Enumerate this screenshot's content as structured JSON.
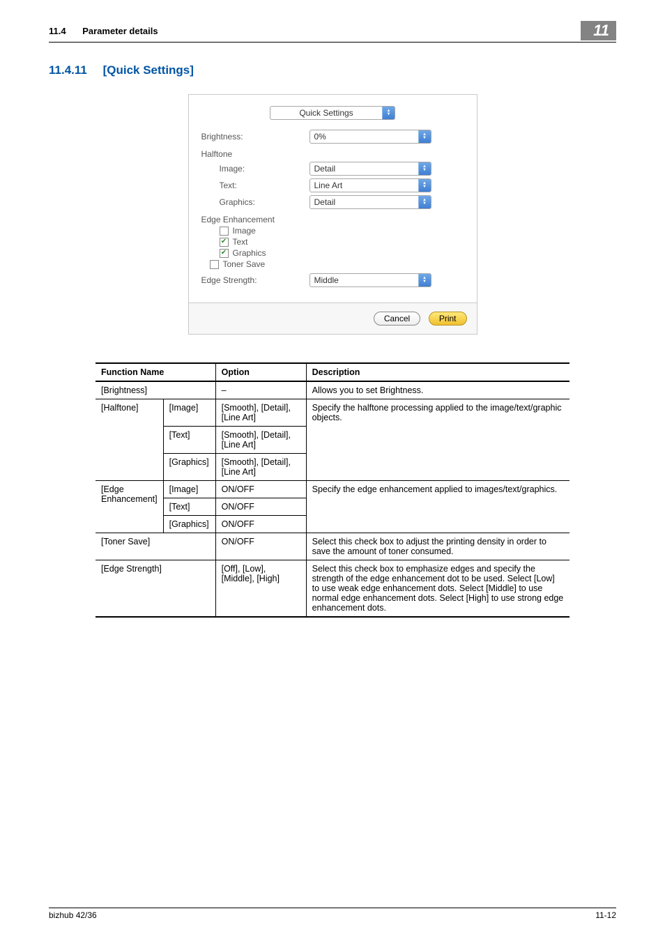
{
  "header": {
    "section_no": "11.4",
    "section_title": "Parameter details",
    "chapter_no": "11"
  },
  "section_heading": {
    "number": "11.4.11",
    "title": "[Quick Settings]"
  },
  "panel": {
    "top_combo": "Quick Settings",
    "brightness_label": "Brightness:",
    "brightness_value": "0%",
    "halftone_label": "Halftone",
    "halftone_image_label": "Image:",
    "halftone_image_value": "Detail",
    "halftone_text_label": "Text:",
    "halftone_text_value": "Line Art",
    "halftone_graphics_label": "Graphics:",
    "halftone_graphics_value": "Detail",
    "edge_enh_label": "Edge Enhancement",
    "chk_image": "Image",
    "chk_text": "Text",
    "chk_graphics": "Graphics",
    "chk_toner": "Toner Save",
    "edge_strength_label": "Edge Strength:",
    "edge_strength_value": "Middle",
    "btn_cancel": "Cancel",
    "btn_print": "Print"
  },
  "table": {
    "head": {
      "fn": "Function Name",
      "opt": "Option",
      "desc": "Description"
    },
    "rows": {
      "brightness": {
        "fn": "[Brightness]",
        "opt": "–",
        "desc": "Allows you to set Brightness."
      },
      "halftone": {
        "fn": "[Halftone]",
        "sub_image": "[Image]",
        "sub_text": "[Text]",
        "sub_graphics": "[Graphics]",
        "opt": "[Smooth], [Detail], [Line Art]",
        "desc": "Specify the halftone processing applied to the image/text/graphic objects."
      },
      "edge": {
        "fn": "[Edge Enhancement]",
        "sub_image": "[Image]",
        "sub_text": "[Text]",
        "sub_graphics": "[Graphics]",
        "opt": "ON/OFF",
        "desc": "Specify the edge enhancement applied to images/text/graphics."
      },
      "toner": {
        "fn": "[Toner Save]",
        "opt": "ON/OFF",
        "desc": "Select this check box to adjust the printing density in order to save the amount of toner consumed."
      },
      "strength": {
        "fn": "[Edge Strength]",
        "opt": "[Off], [Low], [Middle], [High]",
        "desc": "Select this check box to emphasize edges and specify the strength of the edge enhancement dot to be used. Select [Low] to use weak edge enhancement dots. Select [Middle] to use normal edge enhancement dots. Select [High] to use strong edge enhancement dots."
      }
    }
  },
  "footer": {
    "left": "bizhub 42/36",
    "right": "11-12"
  }
}
